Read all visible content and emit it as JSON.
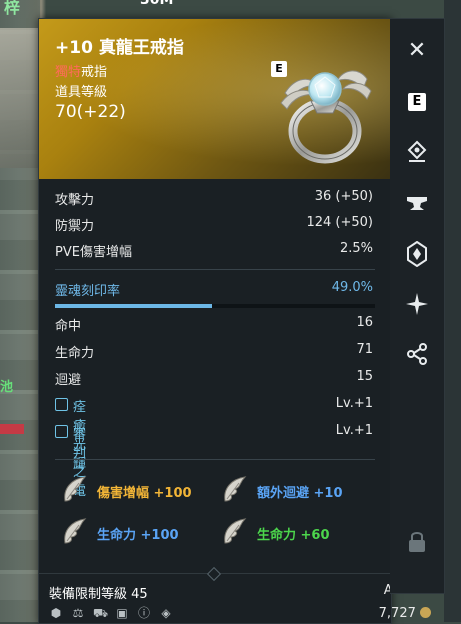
{
  "background": {
    "top_left_text": "梓",
    "top_number": "30M",
    "left_floating_text": "池"
  },
  "item": {
    "name": "+10 真龍王戒指",
    "type_prefix": "獨特",
    "type_suffix": "戒指",
    "level_label": "道具等級",
    "level_value": "70(+22)",
    "grade_badge": "E",
    "header_color": "#c49a1a"
  },
  "stats": [
    {
      "label": "攻擊力",
      "value": "36 (+50)"
    },
    {
      "label": "防禦力",
      "value": "124 (+50)"
    },
    {
      "label": "PVE傷害增幅",
      "value": "2.5%"
    }
  ],
  "soul": {
    "label": "靈魂刻印率",
    "value": "49.0%",
    "percent": 49.0,
    "color": "#6cb7e6"
  },
  "substats": [
    {
      "label": "命中",
      "value": "16"
    },
    {
      "label": "生命力",
      "value": "71"
    },
    {
      "label": "迴避",
      "value": "15"
    }
  ],
  "skills": [
    {
      "label": "痊癒光輝",
      "value": "Lv.+1"
    },
    {
      "label": "審判之電",
      "value": "Lv.+1"
    }
  ],
  "options": [
    {
      "label": "傷害增幅 +100",
      "color": "gold"
    },
    {
      "label": "額外迴避 +10",
      "color": "blue"
    },
    {
      "label": "生命力 +100",
      "color": "blue"
    },
    {
      "label": "生命力 +60",
      "color": "green"
    }
  ],
  "footer": {
    "requirement": "裝備限制等級 45",
    "owner": "Aveline",
    "price": "7,727"
  },
  "sidebar": {
    "buttons": [
      "close-icon",
      "e-grade-icon",
      "location-pin-icon",
      "anvil-icon",
      "crystal-icon",
      "star-burst-icon",
      "share-icon",
      "lock-icon"
    ],
    "close_glyph": "✕",
    "grade_glyph": "E"
  }
}
